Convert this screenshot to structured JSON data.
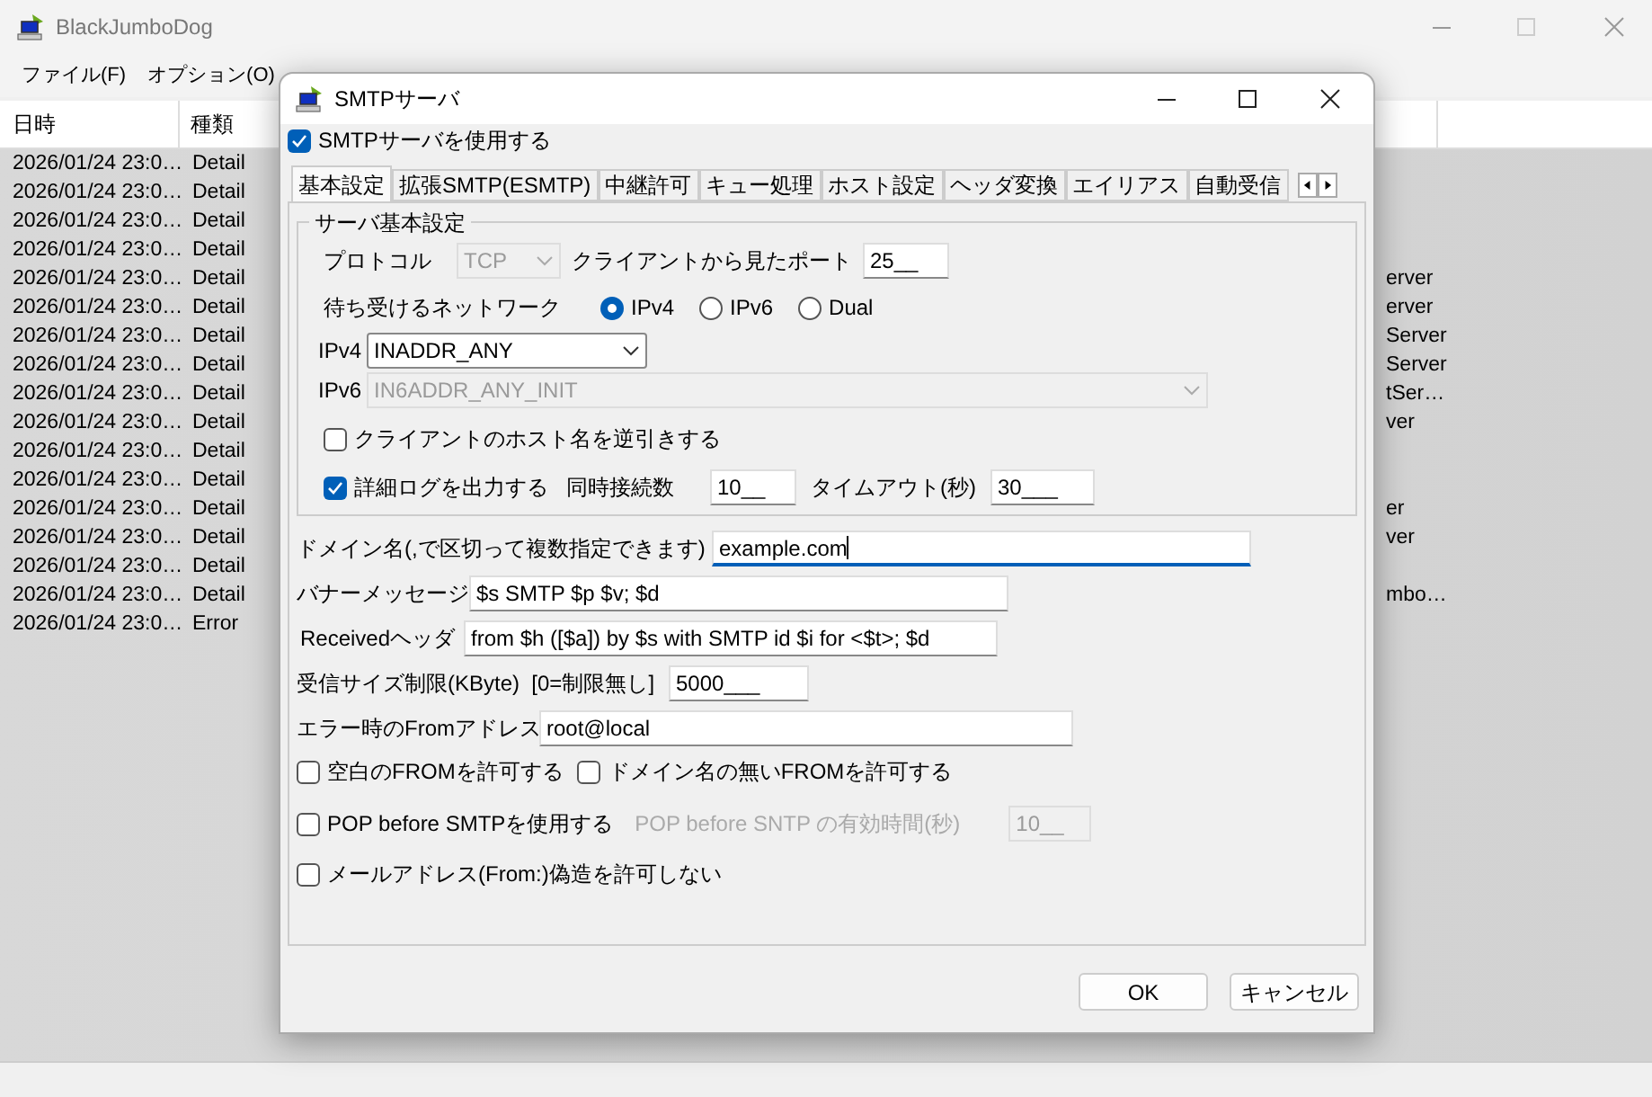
{
  "window": {
    "title": "BlackJumboDog"
  },
  "menu": [
    {
      "label": "ファイル(F)"
    },
    {
      "label": "オプション(O)"
    }
  ],
  "log": {
    "columns": [
      "日時",
      "種類"
    ],
    "rows": [
      {
        "date": "2026/01/24 23:0…",
        "type": "Detail"
      },
      {
        "date": "2026/01/24 23:0…",
        "type": "Detail"
      },
      {
        "date": "2026/01/24 23:0…",
        "type": "Detail"
      },
      {
        "date": "2026/01/24 23:0…",
        "type": "Detail"
      },
      {
        "date": "2026/01/24 23:0…",
        "type": "Detail",
        "column_3": "erver"
      },
      {
        "date": "2026/01/24 23:0…",
        "type": "Detail",
        "column_3": "erver"
      },
      {
        "date": "2026/01/24 23:0…",
        "type": "Detail",
        "column_3": "Server"
      },
      {
        "date": "2026/01/24 23:0…",
        "type": "Detail",
        "column_3": "Server"
      },
      {
        "date": "2026/01/24 23:0…",
        "type": "Detail",
        "column_3": "tSer…"
      },
      {
        "date": "2026/01/24 23:0…",
        "type": "Detail",
        "column_3": "ver"
      },
      {
        "date": "2026/01/24 23:0…",
        "type": "Detail"
      },
      {
        "date": "2026/01/24 23:0…",
        "type": "Detail"
      },
      {
        "date": "2026/01/24 23:0…",
        "type": "Detail",
        "column_3": "er"
      },
      {
        "date": "2026/01/24 23:0…",
        "type": "Detail",
        "column_3": "ver"
      },
      {
        "date": "2026/01/24 23:0…",
        "type": "Detail"
      },
      {
        "date": "2026/01/24 23:0…",
        "type": "Detail",
        "column_3": "mbo…"
      },
      {
        "date": "2026/01/24 23:0…",
        "type": "Error"
      }
    ]
  },
  "dialog": {
    "title": "SMTPサーバ",
    "enable": {
      "label": "SMTPサーバを使用する",
      "checked": true
    },
    "tabs": [
      {
        "label": "基本設定",
        "selected": true
      },
      {
        "label": "拡張SMTP(ESMTP)",
        "selected": false
      },
      {
        "label": "中継許可",
        "selected": false
      },
      {
        "label": "キュー処理",
        "selected": false
      },
      {
        "label": "ホスト設定",
        "selected": false
      },
      {
        "label": "ヘッダ変換",
        "selected": false
      },
      {
        "label": "エイリアス",
        "selected": false
      },
      {
        "label": "自動受信",
        "selected": false
      }
    ],
    "group": {
      "title": "サーバ基本設定",
      "protocol": {
        "label": "プロトコル",
        "value": "TCP",
        "disabled": true
      },
      "port": {
        "label": "クライアントから見たポート",
        "value": "25__"
      },
      "network": {
        "label": "待ち受けるネットワーク",
        "options": [
          {
            "label": "IPv4",
            "selected": true
          },
          {
            "label": "IPv6",
            "selected": false
          },
          {
            "label": "Dual",
            "selected": false
          }
        ]
      },
      "ipv4": {
        "label": "IPv4",
        "value": "INADDR_ANY",
        "disabled": false
      },
      "ipv6": {
        "label": "IPv6",
        "value": "IN6ADDR_ANY_INIT",
        "disabled": true
      },
      "reverse": {
        "label": "クライアントのホスト名を逆引きする",
        "checked": false
      },
      "detail_log": {
        "label": "詳細ログを出力する",
        "checked": true
      },
      "connections": {
        "label": "同時接続数",
        "value": "10__"
      },
      "timeout": {
        "label": "タイムアウト(秒)",
        "value": "30___"
      }
    },
    "domain": {
      "label": "ドメイン名(,で区切って複数指定できます)",
      "value": "example.com",
      "focused": true
    },
    "banner": {
      "label": "バナーメッセージ",
      "value": "$s SMTP $p $v; $d"
    },
    "received": {
      "label": "Receivedヘッダ",
      "value": "from $h ([$a]) by $s with SMTP id $i for <$t>; $d"
    },
    "size": {
      "label": "受信サイズ制限(KByte)  [0=制限無し]",
      "value": "5000___"
    },
    "error_from": {
      "label": "エラー時のFromアドレス",
      "value": "root@local"
    },
    "allow_empty_from": {
      "label": "空白のFROMを許可する",
      "checked": false
    },
    "allow_no_domain": {
      "label": "ドメイン名の無いFROMを許可する",
      "checked": false
    },
    "pop_before_smtp": {
      "label": "POP before SMTPを使用する",
      "checked": false
    },
    "pop_time": {
      "label": "POP before SNTP の有効時間(秒)",
      "value": "10__",
      "disabled": true
    },
    "deny_forgery": {
      "label": "メールアドレス(From:)偽造を許可しない",
      "checked": false
    },
    "buttons": [
      {
        "label": "OK"
      },
      {
        "label": "キャンセル"
      }
    ]
  }
}
